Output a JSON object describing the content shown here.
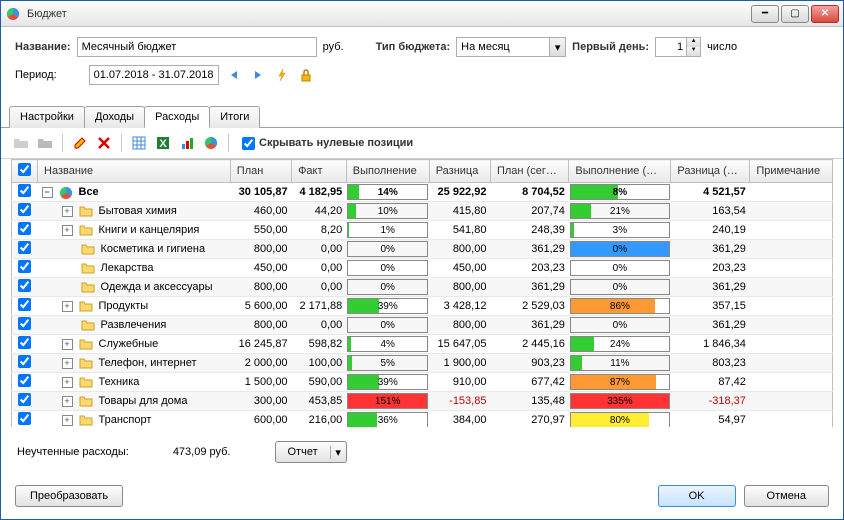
{
  "window": {
    "title": "Бюджет"
  },
  "form": {
    "name_label": "Название:",
    "name_value": "Месячный бюджет",
    "currency_label": "руб.",
    "type_label": "Тип бюджета:",
    "type_value": "На месяц",
    "firstday_label": "Первый день:",
    "firstday_value": "1",
    "firstday_unit": "число",
    "period_label": "Период:",
    "period_value": "01.07.2018 - 31.07.2018"
  },
  "tabs": [
    "Настройки",
    "Доходы",
    "Расходы",
    "Итоги"
  ],
  "active_tab": 2,
  "toolbar": {
    "hide_zero_label": "Скрывать нулевые позиции",
    "hide_zero_checked": true
  },
  "columns": [
    "Название",
    "План",
    "Факт",
    "Выполнение",
    "Разница",
    "План (сег…",
    "Выполнение (…",
    "Разница (…",
    "Примечание"
  ],
  "rows": [
    {
      "checked": true,
      "level": 0,
      "expandable": true,
      "expanded": true,
      "icon": "budget",
      "name": "Все",
      "bold": true,
      "plan": "30 105,87",
      "fact": "4 182,95",
      "exec": {
        "pct": 14,
        "color": "#33cc33",
        "over": false
      },
      "diff": "25 922,92",
      "plan_today": "8 704,52",
      "exec_today": {
        "pct": 48,
        "label": "48%",
        "color": "#33cc33",
        "over": false,
        "truncate": true
      },
      "diff_today": "4 521,57",
      "note": ""
    },
    {
      "checked": true,
      "level": 1,
      "expandable": true,
      "expanded": false,
      "icon": "folder",
      "name": "Бытовая химия",
      "plan": "460,00",
      "fact": "44,20",
      "exec": {
        "pct": 10,
        "color": "#33cc33"
      },
      "diff": "415,80",
      "plan_today": "207,74",
      "exec_today": {
        "pct": 21,
        "color": "#33cc33"
      },
      "diff_today": "163,54",
      "note": ""
    },
    {
      "checked": true,
      "level": 1,
      "expandable": true,
      "expanded": false,
      "icon": "folder",
      "name": "Книги и канцелярия",
      "plan": "550,00",
      "fact": "8,20",
      "exec": {
        "pct": 1,
        "color": "#33cc33"
      },
      "diff": "541,80",
      "plan_today": "248,39",
      "exec_today": {
        "pct": 3,
        "color": "#33cc33"
      },
      "diff_today": "240,19",
      "note": ""
    },
    {
      "checked": true,
      "level": 1,
      "expandable": false,
      "icon": "folder",
      "name": "Косметика и гигиена",
      "plan": "800,00",
      "fact": "0,00",
      "exec": {
        "pct": 0,
        "color": "#33cc33"
      },
      "diff": "800,00",
      "plan_today": "361,29",
      "exec_today": {
        "pct": 0,
        "color": "#3399ff",
        "full": true
      },
      "diff_today": "361,29",
      "note": ""
    },
    {
      "checked": true,
      "level": 1,
      "expandable": false,
      "icon": "folder",
      "name": "Лекарства",
      "plan": "450,00",
      "fact": "0,00",
      "exec": {
        "pct": 0,
        "color": "#33cc33"
      },
      "diff": "450,00",
      "plan_today": "203,23",
      "exec_today": {
        "pct": 0,
        "color": "#33cc33"
      },
      "diff_today": "203,23",
      "note": ""
    },
    {
      "checked": true,
      "level": 1,
      "expandable": false,
      "icon": "folder",
      "name": "Одежда и аксессуары",
      "plan": "800,00",
      "fact": "0,00",
      "exec": {
        "pct": 0,
        "color": "#33cc33"
      },
      "diff": "800,00",
      "plan_today": "361,29",
      "exec_today": {
        "pct": 0,
        "color": "#33cc33"
      },
      "diff_today": "361,29",
      "note": ""
    },
    {
      "checked": true,
      "level": 1,
      "expandable": true,
      "expanded": false,
      "icon": "folder",
      "name": "Продукты",
      "plan": "5 600,00",
      "fact": "2 171,88",
      "exec": {
        "pct": 39,
        "color": "#33cc33"
      },
      "diff": "3 428,12",
      "plan_today": "2 529,03",
      "exec_today": {
        "pct": 86,
        "color": "#ff9933"
      },
      "diff_today": "357,15",
      "note": ""
    },
    {
      "checked": true,
      "level": 1,
      "expandable": false,
      "icon": "folder",
      "name": "Развлечения",
      "plan": "800,00",
      "fact": "0,00",
      "exec": {
        "pct": 0,
        "color": "#33cc33"
      },
      "diff": "800,00",
      "plan_today": "361,29",
      "exec_today": {
        "pct": 0,
        "color": "#33cc33"
      },
      "diff_today": "361,29",
      "note": ""
    },
    {
      "checked": true,
      "level": 1,
      "expandable": true,
      "expanded": false,
      "icon": "folder",
      "name": "Служебные",
      "plan": "16 245,87",
      "fact": "598,82",
      "exec": {
        "pct": 4,
        "color": "#33cc33"
      },
      "diff": "15 647,05",
      "plan_today": "2 445,16",
      "exec_today": {
        "pct": 24,
        "color": "#33cc33"
      },
      "diff_today": "1 846,34",
      "note": ""
    },
    {
      "checked": true,
      "level": 1,
      "expandable": true,
      "expanded": false,
      "icon": "folder",
      "name": "Телефон, интернет",
      "plan": "2 000,00",
      "fact": "100,00",
      "exec": {
        "pct": 5,
        "color": "#33cc33"
      },
      "diff": "1 900,00",
      "plan_today": "903,23",
      "exec_today": {
        "pct": 11,
        "color": "#33cc33"
      },
      "diff_today": "803,23",
      "note": ""
    },
    {
      "checked": true,
      "level": 1,
      "expandable": true,
      "expanded": false,
      "icon": "folder",
      "name": "Техника",
      "plan": "1 500,00",
      "fact": "590,00",
      "exec": {
        "pct": 39,
        "color": "#33cc33"
      },
      "diff": "910,00",
      "plan_today": "677,42",
      "exec_today": {
        "pct": 87,
        "color": "#ff9933"
      },
      "diff_today": "87,42",
      "note": ""
    },
    {
      "checked": true,
      "level": 1,
      "expandable": true,
      "expanded": false,
      "icon": "folder",
      "name": "Товары для дома",
      "plan": "300,00",
      "fact": "453,85",
      "exec": {
        "pct": 151,
        "color": "#ff3333",
        "over": true
      },
      "diff": "-153,85",
      "diff_neg": true,
      "plan_today": "135,48",
      "exec_today": {
        "pct": 335,
        "color": "#ff3333",
        "over": true
      },
      "diff_today": "-318,37",
      "diff_today_neg": true,
      "note": ""
    },
    {
      "checked": true,
      "level": 1,
      "expandable": true,
      "expanded": false,
      "icon": "folder",
      "name": "Транспорт",
      "plan": "600,00",
      "fact": "216,00",
      "exec": {
        "pct": 36,
        "color": "#33cc33"
      },
      "diff": "384,00",
      "plan_today": "270,97",
      "exec_today": {
        "pct": 80,
        "color": "#ffee33"
      },
      "diff_today": "54,97",
      "note": ""
    }
  ],
  "footer": {
    "unaccounted_label": "Неучтенные расходы:",
    "unaccounted_value": "473,09 руб.",
    "report_label": "Отчет",
    "transform_label": "Преобразовать",
    "ok_label": "OK",
    "cancel_label": "Отмена"
  }
}
